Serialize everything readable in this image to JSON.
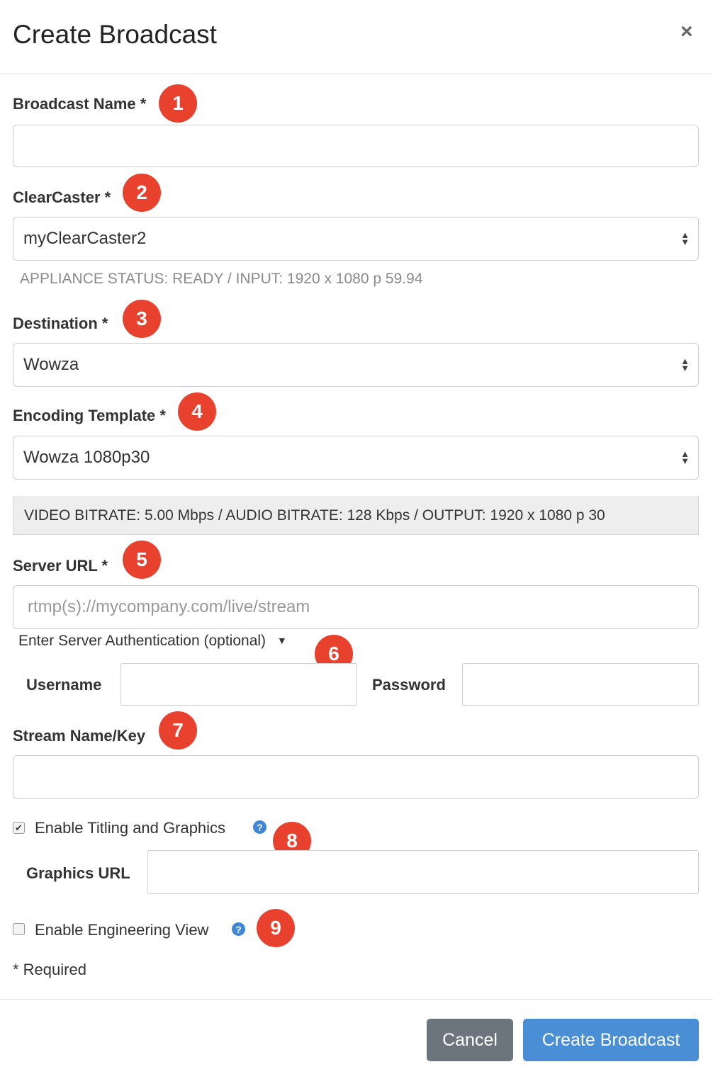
{
  "dialog": {
    "title": "Create Broadcast",
    "close_glyph": "×"
  },
  "badges": [
    "1",
    "2",
    "3",
    "4",
    "5",
    "6",
    "7",
    "8",
    "9"
  ],
  "fields": {
    "broadcast_name": {
      "label": "Broadcast Name *",
      "value": ""
    },
    "clearcaster": {
      "label": "ClearCaster *",
      "value": "myClearCaster2"
    },
    "appliance_status": "APPLIANCE STATUS: READY   /   INPUT: 1920 x 1080 p 59.94",
    "destination": {
      "label": "Destination *",
      "value": "Wowza"
    },
    "encoding_template": {
      "label": "Encoding Template *",
      "value": "Wowza 1080p30"
    },
    "encoding_info": "VIDEO BITRATE: 5.00 Mbps   /   AUDIO BITRATE: 128 Kbps   /   OUTPUT: 1920 x 1080 p 30",
    "server_url": {
      "label": "Server URL *",
      "placeholder": "rtmp(s)://mycompany.com/live/stream"
    },
    "server_auth_toggle": "Enter Server Authentication (optional)",
    "username": {
      "label": "Username",
      "value": ""
    },
    "password": {
      "label": "Password",
      "value": ""
    },
    "stream_name": {
      "label": "Stream Name/Key",
      "value": ""
    },
    "titling": {
      "label": "Enable Titling and Graphics",
      "checked": true
    },
    "graphics_url": {
      "label": "Graphics URL",
      "value": ""
    },
    "engineering_view": {
      "label": "Enable Engineering View",
      "checked": false
    },
    "required_note": "* Required"
  },
  "footer": {
    "cancel_label": "Cancel",
    "create_label": "Create Broadcast"
  },
  "colors": {
    "badge": "#e8412e",
    "primary_button": "#4a8fd6",
    "cancel_button": "#6c757d",
    "help_icon": "#3e87d6"
  },
  "icons": {
    "select": "updown-arrows-icon",
    "dropdown": "caret-down-icon",
    "help": "question-circle-icon",
    "checkbox_checked": "check-icon"
  }
}
